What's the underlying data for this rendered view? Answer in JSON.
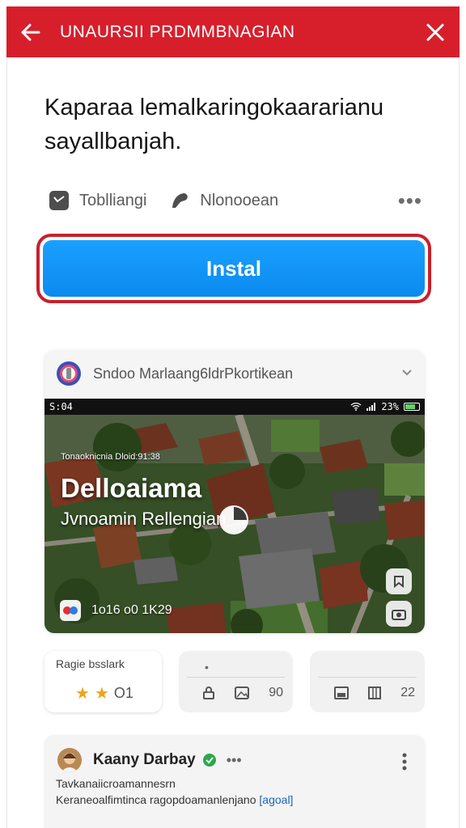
{
  "header": {
    "title": "UNAURSII PRDMMBNAGIAN",
    "back_icon": "arrow-left-icon",
    "close_icon": "close-icon",
    "bg_color": "#d71f2c"
  },
  "headline": {
    "line1": "Kaparaa lemalkaringokaararianu",
    "line2": "sayallbanjah."
  },
  "meta": {
    "item1_label": "Toblliangi",
    "item2_label": "Nlonooean"
  },
  "install": {
    "label": "Instal",
    "color": "#1aa0ff"
  },
  "card": {
    "title": "Sndoo Marlaang6ldrPkortikean",
    "statusbar_time": "S:04",
    "statusbar_right": "23%",
    "overlay_small": "Tonaoknicnia Dloid:91:38",
    "overlay_title": "Delloaiama",
    "overlay_subtitle": "Jvnoamin Rellengian",
    "overlay_bottom": "1o16 o0 1K29"
  },
  "tiles": {
    "tile1_label": "Ragie bsslark",
    "tile1_rating": 2,
    "tile1_bubble": "O1",
    "tile2_count": "90",
    "tile3_count": "22"
  },
  "comment": {
    "name": "Kaany Darbay",
    "line1": "Tavkanaiicroamannesrn",
    "line2": "Keraneoalfimtinca ragopdoamanlenjano",
    "link": "[agoal]"
  }
}
